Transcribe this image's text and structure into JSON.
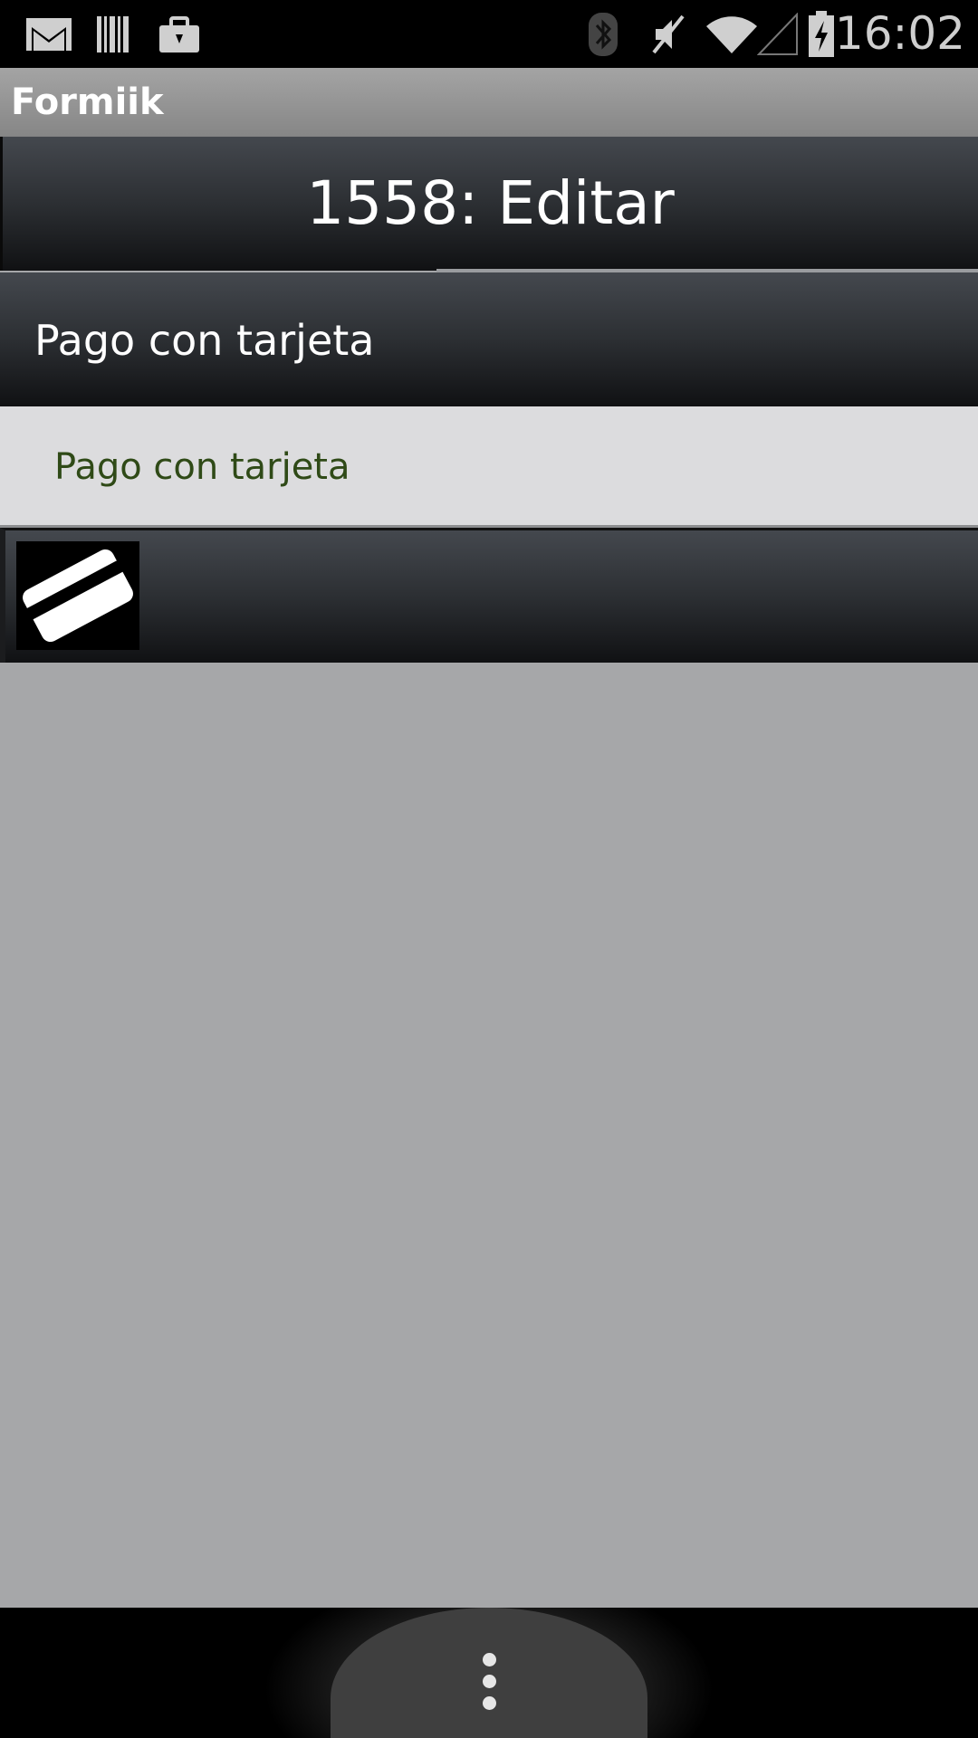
{
  "status_bar": {
    "time": "16:02",
    "left_icons": [
      "gmail-icon",
      "barcode-icon",
      "briefcase-icon"
    ],
    "right_icons": [
      "bluetooth-icon",
      "mute-icon",
      "wifi-icon",
      "signal-icon",
      "battery-charging-icon"
    ]
  },
  "app": {
    "title": "Formiik"
  },
  "header": {
    "title": "1558: Editar"
  },
  "section": {
    "label": "Pago con tarjeta"
  },
  "option": {
    "label": "Pago con tarjeta"
  },
  "card_row": {
    "icon": "credit-card-icon"
  },
  "nav_bar": {
    "menu_icon": "overflow-menu-icon"
  },
  "colors": {
    "status_bar": "#000000",
    "title_bar": "#969696",
    "header_gradient_top": "#44484e",
    "header_gradient_bottom": "#101113",
    "option_bg": "#dcdcde",
    "option_text": "#2f4a17",
    "content_bg": "#a6a7a9"
  }
}
